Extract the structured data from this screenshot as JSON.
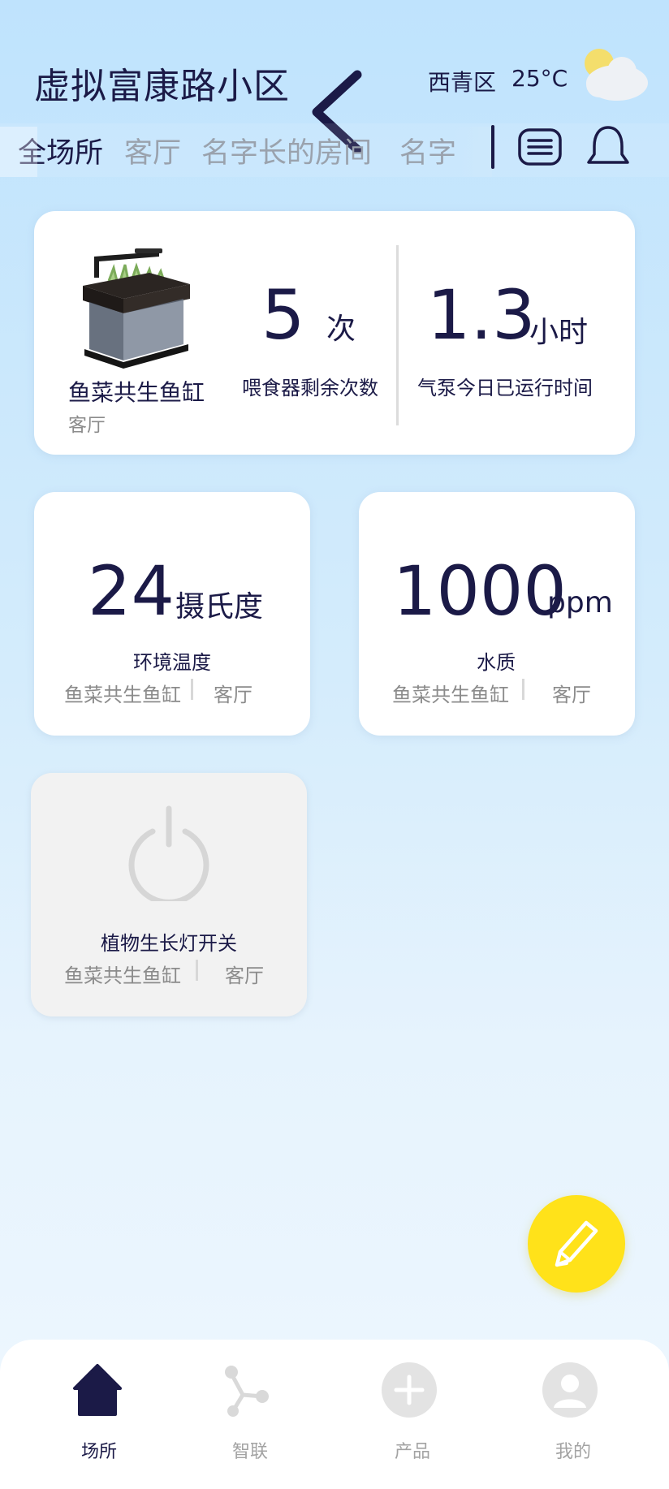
{
  "header": {
    "community_name": "虚拟富康路小区",
    "district": "西青区",
    "temperature": "25°C",
    "weather_icon": "partly-cloudy-icon",
    "back_icon": "chevron-left-icon"
  },
  "tabs": [
    {
      "label": "全场所",
      "active": true
    },
    {
      "label": "客厅",
      "active": false
    },
    {
      "label": "名字长的房间",
      "active": false
    },
    {
      "label": "名字",
      "active": false
    }
  ],
  "toolbar": {
    "menu_icon": "menu-list-icon",
    "bell_icon": "bell-icon"
  },
  "main_card": {
    "device_name": "鱼菜共生鱼缸",
    "room": "客厅",
    "feeder": {
      "value": "5",
      "unit": "次",
      "label": "喂食器剩余次数"
    },
    "pump": {
      "value": "1.3",
      "unit": "小时",
      "label": "气泵今日已运行时间"
    }
  },
  "temperature_card": {
    "value": "24",
    "unit": "摄氏度",
    "label": "环境温度",
    "device": "鱼菜共生鱼缸",
    "room": "客厅"
  },
  "water_card": {
    "value": "1000",
    "unit": "ppm",
    "label": "水质",
    "device": "鱼菜共生鱼缸",
    "room": "客厅"
  },
  "light_card": {
    "label": "植物生长灯开关",
    "device": "鱼菜共生鱼缸",
    "room": "客厅",
    "state": "off",
    "icon": "power-icon"
  },
  "fab": {
    "icon": "pencil-icon",
    "color": "#ffe21a"
  },
  "bottom_nav": [
    {
      "label": "场所",
      "icon": "home-icon",
      "active": true
    },
    {
      "label": "智联",
      "icon": "share-nodes-icon",
      "active": false
    },
    {
      "label": "产品",
      "icon": "plus-circle-icon",
      "active": false
    },
    {
      "label": "我的",
      "icon": "user-icon",
      "active": false
    }
  ],
  "colors": {
    "primary": "#1b1a47",
    "muted": "#9aa2ad",
    "accent": "#ffe21a",
    "background_top": "#bfe3fd"
  }
}
